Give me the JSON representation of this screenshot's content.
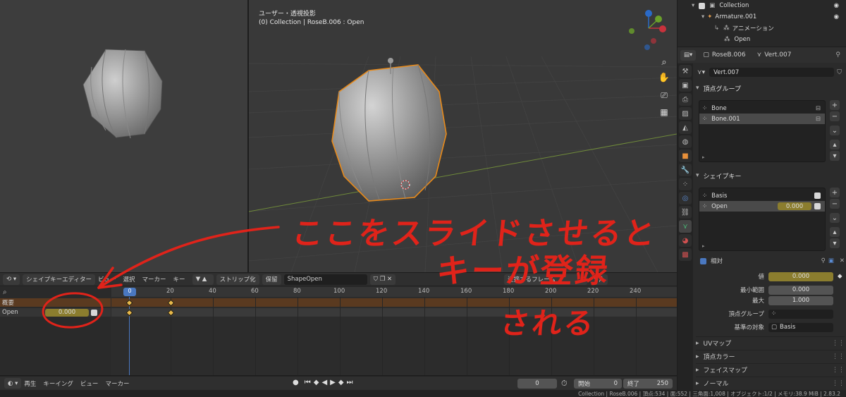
{
  "viewport_main": {
    "title": "ユーザー・透視投影",
    "subtitle": "(0) Collection | RoseB.006 : Open"
  },
  "dope_header": {
    "mode": "シェイプキーエディター",
    "menus": [
      "ビュー",
      "選択",
      "マーカー",
      "キー"
    ],
    "push_down": "ストリップ化",
    "stash": "保留",
    "action_name": "ShapeOpen",
    "snap": "近接するフレーム"
  },
  "ruler": {
    "ticks": [
      "20",
      "40",
      "60",
      "80",
      "100",
      "120",
      "140",
      "160",
      "180",
      "200",
      "220",
      "240"
    ],
    "current": "0"
  },
  "channels": {
    "summary_label": "概要",
    "open_label": "Open",
    "open_value": "0.000"
  },
  "playback": {
    "menus": [
      "再生",
      "キーイング",
      "ビュー",
      "マーカー"
    ],
    "current_frame": "0",
    "start_label": "開始",
    "start_value": "0",
    "end_label": "終了",
    "end_value": "250"
  },
  "statusbar": {
    "text": "Collection | RoseB.006 | 頂点:534 | 面:552 | 三角面:1,008 | オブジェクト:1/2 | メモリ:38.9 MiB | 2.83.2"
  },
  "outliner": {
    "items": [
      "Collection",
      "Armature.001",
      "アニメーション",
      "Open"
    ]
  },
  "props": {
    "breadcrumb_object": "RoseB.006",
    "breadcrumb_data": "Vert.007",
    "data_name": "Vert.007",
    "vertex_groups": {
      "title": "頂点グループ",
      "items": [
        "Bone",
        "Bone.001"
      ]
    },
    "shape_keys": {
      "title": "シェイプキー",
      "items": [
        {
          "name": "Basis",
          "value": ""
        },
        {
          "name": "Open",
          "value": "0.000"
        }
      ],
      "relative_label": "相対",
      "value_label": "値",
      "value": "0.000",
      "min_label": "最小範囲",
      "min": "0.000",
      "max_label": "最大",
      "max": "1.000",
      "vgroup_label": "頂点グループ",
      "relative_to_label": "基準の対象",
      "relative_to": "Basis"
    },
    "collapsed_panels": [
      "UVマップ",
      "頂点カラー",
      "フェイスマップ",
      "ノーマル"
    ]
  },
  "annotation": {
    "line1": "ここをスライドさせると",
    "line2": "キーが登録",
    "line3": "される",
    "color": "#e0231a"
  }
}
